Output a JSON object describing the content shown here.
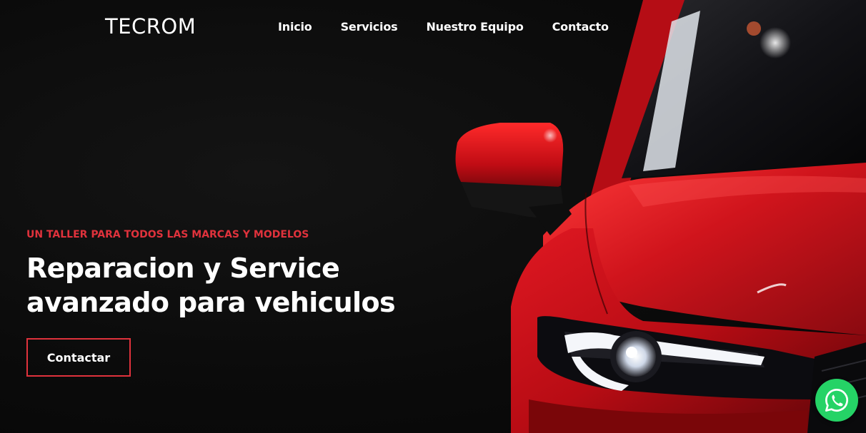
{
  "brand": {
    "logo": "TECROM"
  },
  "nav": {
    "items": [
      {
        "label": "Inicio"
      },
      {
        "label": "Servicios"
      },
      {
        "label": "Nuestro Equipo"
      },
      {
        "label": "Contacto"
      }
    ]
  },
  "hero": {
    "kicker": "UN TALLER PARA TODOS LAS MARCAS Y MODELOS",
    "headline_line1": "Reparacion y Service",
    "headline_line2": "avanzado para vehiculos",
    "cta_label": "Contactar"
  },
  "icons": {
    "whatsapp": "whatsapp-icon"
  },
  "colors": {
    "accent": "#e0323c",
    "background": "#0a0a0a",
    "text": "#ffffff",
    "whatsapp": "#25d366",
    "car": "#c8101a"
  }
}
